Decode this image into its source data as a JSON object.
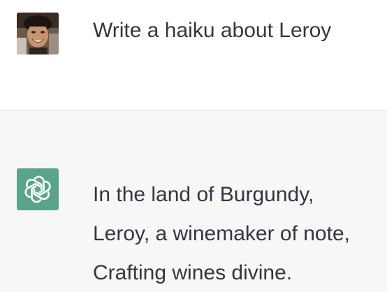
{
  "user_message": {
    "text": "Write a haiku about Leroy",
    "avatar": "user-photo-avatar"
  },
  "assistant_message": {
    "avatar": "openai-logo-icon",
    "avatar_color": "#5aa58a",
    "lines": [
      "In the land of Burgundy,",
      "Leroy, a winemaker of note,",
      "Crafting wines divine."
    ]
  },
  "colors": {
    "assistant_background": "#f7f7f8",
    "user_background": "#ffffff",
    "text": "#343541"
  }
}
